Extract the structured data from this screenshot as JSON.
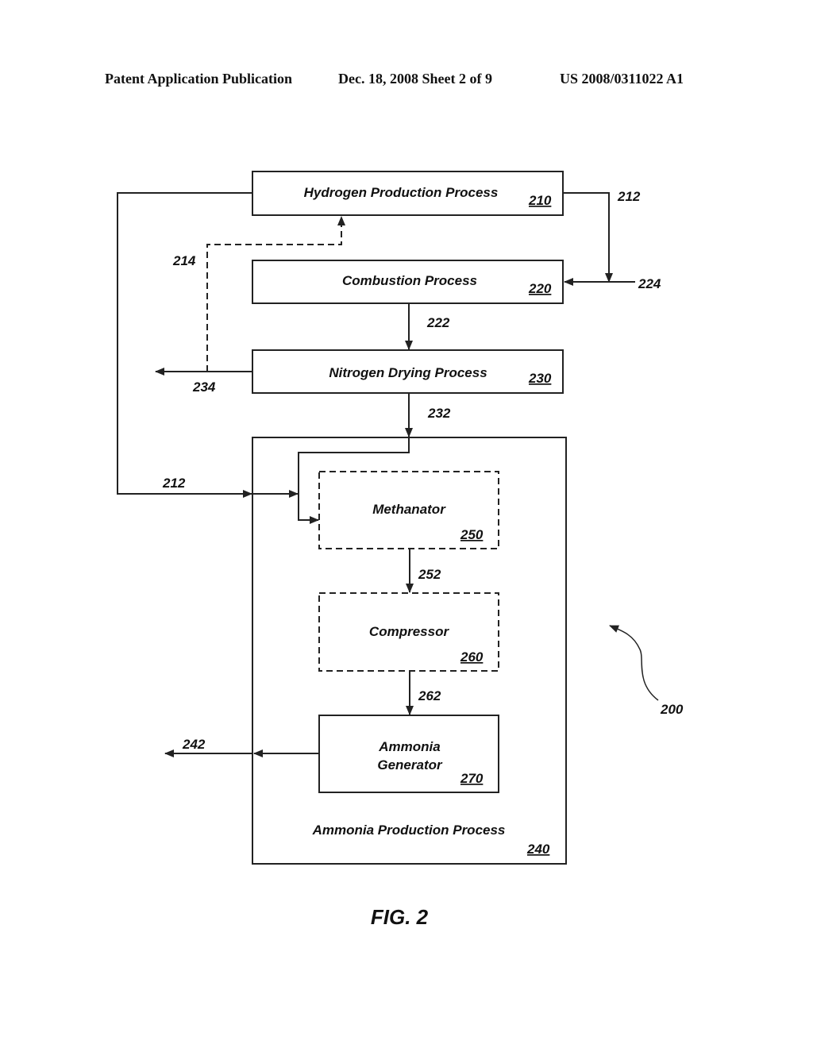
{
  "header": {
    "left": "Patent Application Publication",
    "middle": "Dec. 18, 2008   Sheet 2 of 9",
    "right": "US 2008/0311022 A1"
  },
  "blocks": {
    "hydrogen": {
      "label": "Hydrogen Production Process",
      "ref": "210"
    },
    "combustion": {
      "label": "Combustion Process",
      "ref": "220"
    },
    "nitrogen": {
      "label": "Nitrogen Drying Process",
      "ref": "230"
    },
    "ammonia_process": {
      "label": "Ammonia Production Process",
      "ref": "240"
    },
    "methanator": {
      "label": "Methanator",
      "ref": "250"
    },
    "compressor": {
      "label": "Compressor",
      "ref": "260"
    },
    "generator": {
      "label_line1": "Ammonia",
      "label_line2": "Generator",
      "ref": "270"
    }
  },
  "streams": {
    "s212_top": "212",
    "s212_left": "212",
    "s214": "214",
    "s222": "222",
    "s224": "224",
    "s232": "232",
    "s234": "234",
    "s242": "242",
    "s252": "252",
    "s262": "262"
  },
  "system_ref": "200",
  "figure_label": "FIG. 2"
}
